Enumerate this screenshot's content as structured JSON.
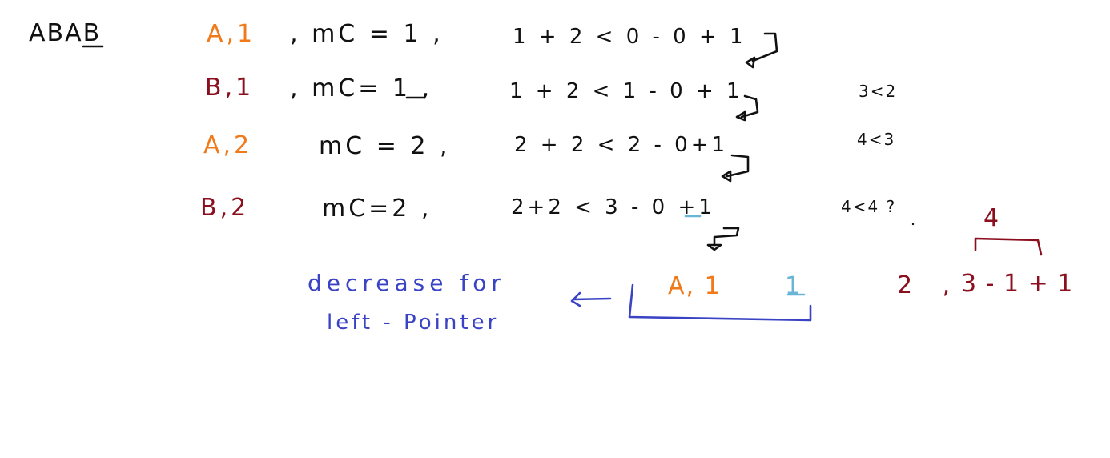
{
  "colors": {
    "black": "#111111",
    "orange": "#f07a1a",
    "maroon": "#8b0f1e",
    "blue": "#3a43c4",
    "light_blue": "#6ab4d8"
  },
  "header": {
    "string": "ABAB"
  },
  "rows": [
    {
      "pair": "A,1",
      "pair_color": "orange",
      "mc": ", mC = 1 ,",
      "expr": "1 + 2 < 0 - 0 + 1",
      "compare": ""
    },
    {
      "pair": "B,1",
      "pair_color": "maroon",
      "mc": ", mC= 1 ,",
      "expr": "1 + 2 < 1 - 0 + 1",
      "compare": "3<2"
    },
    {
      "pair": "A,2",
      "pair_color": "orange",
      "mc": "mC = 2 ,",
      "expr": "2 + 2 < 2 - 0+1",
      "compare": "4<3"
    },
    {
      "pair": "B,2",
      "pair_color": "maroon",
      "mc": "mC=2 ,",
      "expr": "2+2 < 3 - 0 +1",
      "compare": "4<4 ?"
    }
  ],
  "note": {
    "line1": "decrease for",
    "line2": "left - Pointer"
  },
  "window_box": {
    "pair": "A, 1",
    "value": "1"
  },
  "right_calc": {
    "count": "2 ,",
    "expr": "3 - 1 + 1",
    "brace_label": "4"
  }
}
